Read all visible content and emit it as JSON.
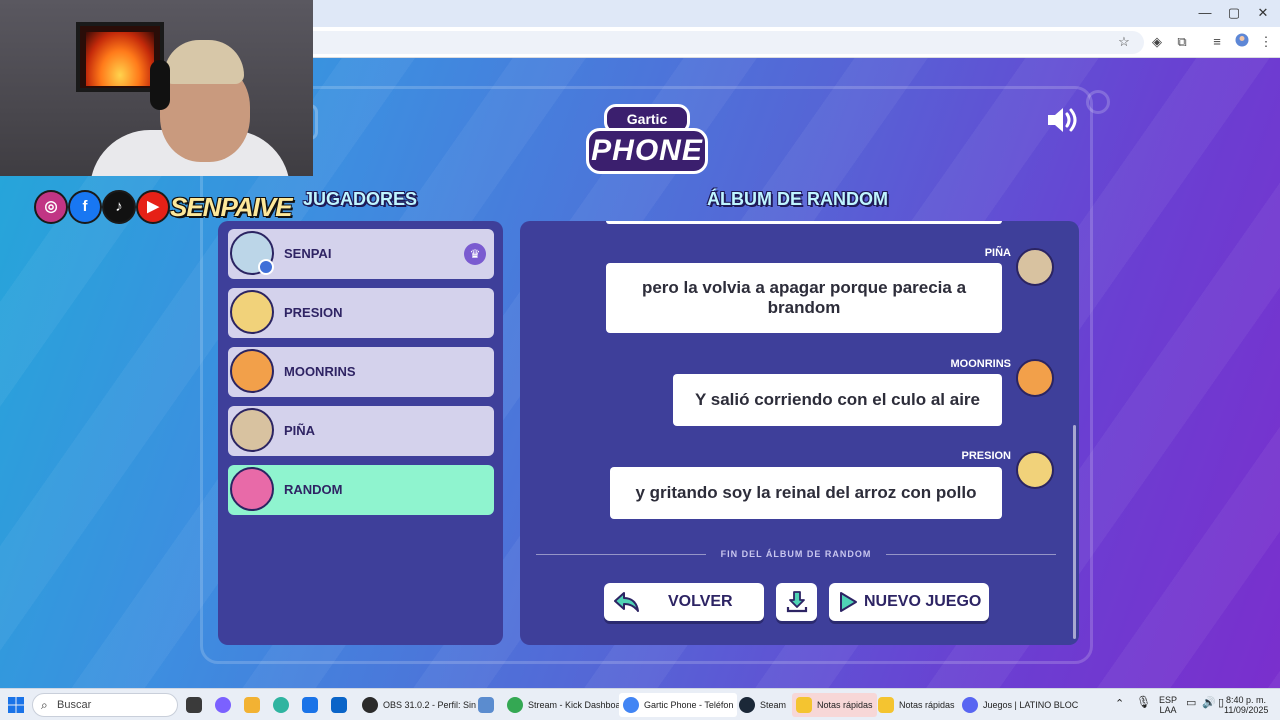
{
  "browser": {
    "window_controls": {
      "minimize": "—",
      "maximize": "▢",
      "close": "✕"
    }
  },
  "game": {
    "logo": {
      "top": "Gartic",
      "bottom": "PHONE"
    },
    "players_title": "JUGADORES",
    "album_title": "ÁLBUM DE RANDOM",
    "players": [
      {
        "name": "SENPAI",
        "avatar_color": "#bcd6e8",
        "host": true
      },
      {
        "name": "PRESION",
        "avatar_color": "#f1d27a"
      },
      {
        "name": "MOONRINS",
        "avatar_color": "#f2a04a"
      },
      {
        "name": "PIÑA",
        "avatar_color": "#d8c2a0"
      },
      {
        "name": "RANDOM",
        "avatar_color": "#e86aa8",
        "active": true
      }
    ],
    "messages": [
      {
        "author": "PIÑA",
        "text": "pero la volvia a apagar porque parecia a brandom",
        "avatar_color": "#d8c2a0"
      },
      {
        "author": "MOONRINS",
        "text": "Y salió corriendo con el culo al aire",
        "avatar_color": "#f2a04a"
      },
      {
        "author": "PRESION",
        "text": "y gritando soy la reinal del arroz con pollo",
        "avatar_color": "#f1d27a"
      }
    ],
    "album_end": "FIN DEL ÁLBUM DE RANDOM",
    "buttons": {
      "back": "VOLVER",
      "new_game": "NUEVO JUEGO"
    },
    "colors": {
      "active_player": "#8ff4cf",
      "panel": "#3e3f9a",
      "title": "#bff5ff"
    }
  },
  "overlay": {
    "social_icons": [
      "instagram-icon",
      "facebook-icon",
      "tiktok-icon",
      "youtube-icon"
    ],
    "handle": "SENPAIVE"
  },
  "taskbar": {
    "search_placeholder": "Buscar",
    "apps": [
      {
        "label": "OBS 31.0.2 - Perfil: Sin",
        "color": "#2b2b2b"
      },
      {
        "label": "Stream - Kick Dashboa",
        "color": "#34a853"
      },
      {
        "label": "Gartic Phone - Teléfon",
        "color": "#4285f4"
      },
      {
        "label": "Steam",
        "color": "#1b2838"
      },
      {
        "label": "Notas rápidas",
        "color": "#f4c430"
      },
      {
        "label": "Notas rápidas",
        "color": "#f4c430"
      },
      {
        "label": "Juegos | LATINO BLOC",
        "color": "#5865f2"
      }
    ],
    "lang_top": "ESP",
    "lang_bottom": "LAA",
    "time": "8:40 p. m.",
    "date": "11/09/2025"
  }
}
